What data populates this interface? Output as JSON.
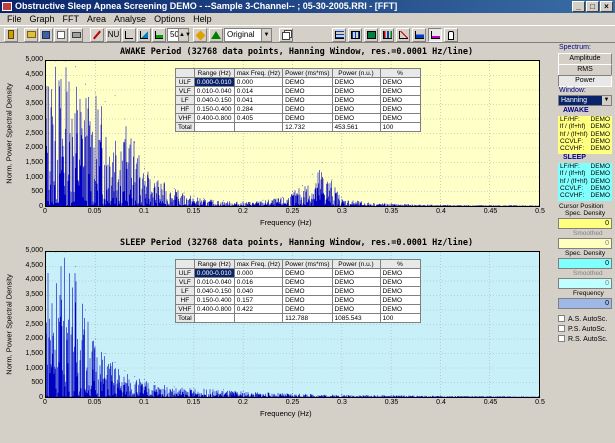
{
  "window": {
    "title": "Obstructive Sleep Apnea Screening DEMO  - --Sample 3-Channel-- ; 05-30-2005.RRI - [FFT]",
    "min": "_",
    "max": "□",
    "close": "×"
  },
  "menu": [
    "File",
    "Graph",
    "FFT",
    "Area",
    "Analyse",
    "Options",
    "Help"
  ],
  "toolbar": {
    "nu_label": "NU",
    "spin_value": "50",
    "spin_arrows": "▲▼",
    "view_select": "Original",
    "dropdown_arrow": "▼"
  },
  "charts": [
    {
      "title": "AWAKE Period   (32768 data points, Hanning Window, res.=0.0001  Hz/line)",
      "ylabel": "Norm. Power Spectral Density",
      "xlabel": "Frequency (Hz)",
      "yticks": [
        "5,000",
        "4,500",
        "4,000",
        "3,500",
        "3,000",
        "2,500",
        "2,000",
        "1,500",
        "1,000",
        "500",
        "0"
      ],
      "xticks": [
        "0",
        "0.05",
        "0.1",
        "0.15",
        "0.2",
        "0.25",
        "0.3",
        "0.35",
        "0.4",
        "0.45",
        "0.5"
      ],
      "bg": "#ffffc8",
      "table": {
        "headers": [
          "",
          "Range (Hz)",
          "max Freq. (Hz)",
          "Power (ms*ms)",
          "Power (n.u.)",
          "%"
        ],
        "rows": [
          [
            "ULF",
            "0.000-0.010",
            "0.000",
            "DEMO",
            "DEMO",
            "DEMO"
          ],
          [
            "VLF",
            "0.010-0.040",
            "0.014",
            "DEMO",
            "DEMO",
            "DEMO"
          ],
          [
            "LF",
            "0.040-0.150",
            "0.041",
            "DEMO",
            "DEMO",
            "DEMO"
          ],
          [
            "HF",
            "0.150-0.400",
            "0.284",
            "DEMO",
            "DEMO",
            "DEMO"
          ],
          [
            "VHF",
            "0.400-0.800",
            "0.405",
            "DEMO",
            "DEMO",
            "DEMO"
          ],
          [
            "Total",
            "",
            "",
            "12.732",
            "453.561",
            "100"
          ]
        ]
      }
    },
    {
      "title": "SLEEP Period   (32768 data points, Hanning Window, res.=0.0001  Hz/line)",
      "ylabel": "Norm. Power Spectral Density",
      "xlabel": "Frequency (Hz)",
      "yticks": [
        "5,000",
        "4,500",
        "4,000",
        "3,500",
        "3,000",
        "2,500",
        "2,000",
        "1,500",
        "1,000",
        "500",
        "0"
      ],
      "xticks": [
        "0",
        "0.05",
        "0.1",
        "0.15",
        "0.2",
        "0.25",
        "0.3",
        "0.35",
        "0.4",
        "0.45",
        "0.5"
      ],
      "bg": "#c8f0f8",
      "table": {
        "headers": [
          "",
          "Range (Hz)",
          "max Freq. (Hz)",
          "Power (ms*ms)",
          "Power (n.u.)",
          "%"
        ],
        "rows": [
          [
            "ULF",
            "0.000-0.010",
            "0.000",
            "DEMO",
            "DEMO",
            "DEMO"
          ],
          [
            "VLF",
            "0.010-0.040",
            "0.016",
            "DEMO",
            "DEMO",
            "DEMO"
          ],
          [
            "LF",
            "0.040-0.150",
            "0.040",
            "DEMO",
            "DEMO",
            "DEMO"
          ],
          [
            "HF",
            "0.150-0.400",
            "0.157",
            "DEMO",
            "DEMO",
            "DEMO"
          ],
          [
            "VHF",
            "0.400-0.800",
            "0.422",
            "DEMO",
            "DEMO",
            "DEMO"
          ],
          [
            "Total",
            "",
            "",
            "112.788",
            "1085.543",
            "100"
          ]
        ]
      }
    }
  ],
  "chart_data": [
    {
      "type": "area",
      "title": "AWAKE Period (32768 data points, Hanning Window, res.=0.0001 Hz/line)",
      "xlabel": "Frequency (Hz)",
      "ylabel": "Norm. Power Spectral Density",
      "xlim": [
        0,
        0.5
      ],
      "ylim": [
        0,
        5000
      ],
      "x": [
        0,
        0.01,
        0.02,
        0.03,
        0.04,
        0.05,
        0.06,
        0.07,
        0.08,
        0.09,
        0.1,
        0.11,
        0.12,
        0.13,
        0.14,
        0.15,
        0.16,
        0.18,
        0.2,
        0.22,
        0.24,
        0.25,
        0.26,
        0.27,
        0.28,
        0.29,
        0.3,
        0.32,
        0.35,
        0.4,
        0.45,
        0.5
      ],
      "y": [
        5000,
        5000,
        5000,
        4800,
        4200,
        3900,
        3600,
        3800,
        3000,
        2200,
        1300,
        1000,
        800,
        600,
        450,
        350,
        250,
        180,
        150,
        200,
        300,
        500,
        700,
        1100,
        1500,
        900,
        300,
        150,
        80,
        40,
        30,
        20
      ]
    },
    {
      "type": "area",
      "title": "SLEEP Period (32768 data points, Hanning Window, res.=0.0001 Hz/line)",
      "xlabel": "Frequency (Hz)",
      "ylabel": "Norm. Power Spectral Density",
      "xlim": [
        0,
        0.5
      ],
      "ylim": [
        0,
        5000
      ],
      "x": [
        0,
        0.01,
        0.02,
        0.03,
        0.04,
        0.05,
        0.06,
        0.07,
        0.08,
        0.09,
        0.1,
        0.11,
        0.12,
        0.13,
        0.15,
        0.18,
        0.2,
        0.25,
        0.3,
        0.35,
        0.4,
        0.45,
        0.5
      ],
      "y": [
        5000,
        5000,
        5000,
        4500,
        3000,
        2000,
        1500,
        1200,
        900,
        700,
        600,
        500,
        400,
        350,
        300,
        250,
        200,
        120,
        80,
        60,
        40,
        30,
        20
      ]
    }
  ],
  "side": {
    "spectrum_label": "Spectrum:",
    "btn_amplitude": "Amplitude",
    "btn_rms": "RMS",
    "btn_power": "Power",
    "window_label": "Window:",
    "window_value": "Hanning",
    "awake_label": "AWAKE",
    "awake_rows": [
      [
        "LF/HF:",
        "DEMO"
      ],
      [
        "lf / (lf+hf)",
        "DEMO"
      ],
      [
        "hf / (lf+hf)",
        "DEMO"
      ],
      [
        "CCVLF:",
        "DEMO"
      ],
      [
        "CCVHF:",
        "DEMO"
      ]
    ],
    "sleep_label": "SLEEP",
    "sleep_rows": [
      [
        "LF/HF:",
        "DEMO"
      ],
      [
        "lf / (lf+hf)",
        "DEMO"
      ],
      [
        "hf / (lf+hf)",
        "DEMO"
      ],
      [
        "CCVLF:",
        "DEMO"
      ],
      [
        "CCVHF:",
        "DEMO"
      ]
    ],
    "cursor_label": "Cursor Position",
    "spec_density_label": "Spec. Density",
    "spec_density_value": "0",
    "smoothed_label": "Smoothed",
    "smoothed_value": "0",
    "frequency_label": "Frequency",
    "frequency_value": "0",
    "chk_as": "A.S. AutoSc.",
    "chk_ps": "P.S. AutoSc.",
    "chk_rs": "R.S. AutoSc.",
    "colors": {
      "awake": "#ffff80",
      "sleep": "#80ffff"
    }
  }
}
